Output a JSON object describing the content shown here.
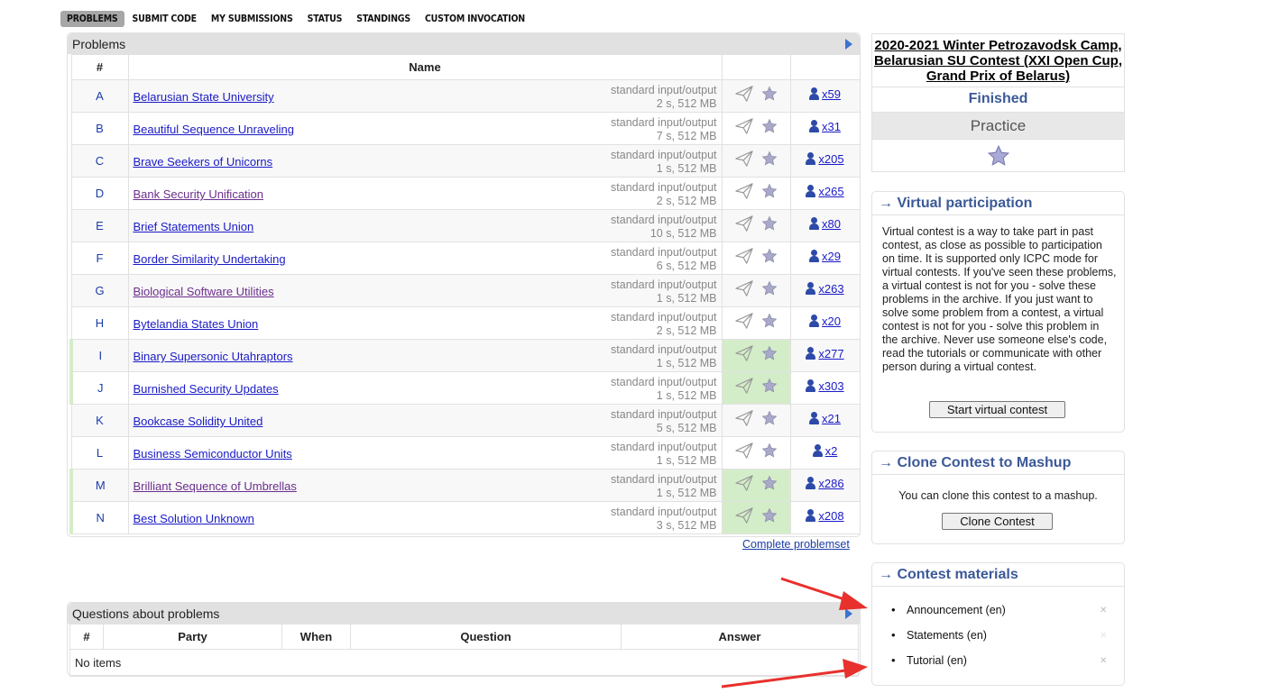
{
  "menu": {
    "items": [
      {
        "label": "PROBLEMS",
        "active": true
      },
      {
        "label": "SUBMIT CODE"
      },
      {
        "label": "MY SUBMISSIONS"
      },
      {
        "label": "STATUS"
      },
      {
        "label": "STANDINGS"
      },
      {
        "label": "CUSTOM INVOCATION"
      }
    ]
  },
  "problems_box": {
    "caption": "Problems",
    "header": {
      "id": "#",
      "name": "Name"
    },
    "rows": [
      {
        "id": "A",
        "name": "Belarusian State University",
        "io": "standard input/output",
        "limits": "2 s, 512 MB",
        "solved": "x59",
        "accepted": false,
        "visited": false
      },
      {
        "id": "B",
        "name": "Beautiful Sequence Unraveling",
        "io": "standard input/output",
        "limits": "7 s, 512 MB",
        "solved": "x31",
        "accepted": false,
        "visited": false
      },
      {
        "id": "C",
        "name": "Brave Seekers of Unicorns",
        "io": "standard input/output",
        "limits": "1 s, 512 MB",
        "solved": "x205",
        "accepted": false,
        "visited": false
      },
      {
        "id": "D",
        "name": "Bank Security Unification",
        "io": "standard input/output",
        "limits": "2 s, 512 MB",
        "solved": "x265",
        "accepted": false,
        "visited": true
      },
      {
        "id": "E",
        "name": "Brief Statements Union",
        "io": "standard input/output",
        "limits": "10 s, 512 MB",
        "solved": "x80",
        "accepted": false,
        "visited": false
      },
      {
        "id": "F",
        "name": "Border Similarity Undertaking",
        "io": "standard input/output",
        "limits": "6 s, 512 MB",
        "solved": "x29",
        "accepted": false,
        "visited": false
      },
      {
        "id": "G",
        "name": "Biological Software Utilities",
        "io": "standard input/output",
        "limits": "1 s, 512 MB",
        "solved": "x263",
        "accepted": false,
        "visited": true
      },
      {
        "id": "H",
        "name": "Bytelandia States Union",
        "io": "standard input/output",
        "limits": "2 s, 512 MB",
        "solved": "x20",
        "accepted": false,
        "visited": false
      },
      {
        "id": "I",
        "name": "Binary Supersonic Utahraptors",
        "io": "standard input/output",
        "limits": "1 s, 512 MB",
        "solved": "x277",
        "accepted": true,
        "visited": false
      },
      {
        "id": "J",
        "name": "Burnished Security Updates",
        "io": "standard input/output",
        "limits": "1 s, 512 MB",
        "solved": "x303",
        "accepted": true,
        "visited": false
      },
      {
        "id": "K",
        "name": "Bookcase Solidity United",
        "io": "standard input/output",
        "limits": "5 s, 512 MB",
        "solved": "x21",
        "accepted": false,
        "visited": false
      },
      {
        "id": "L",
        "name": "Business Semiconductor Units",
        "io": "standard input/output",
        "limits": "1 s, 512 MB",
        "solved": "x2",
        "accepted": false,
        "visited": false
      },
      {
        "id": "M",
        "name": "Brilliant Sequence of Umbrellas",
        "io": "standard input/output",
        "limits": "1 s, 512 MB",
        "solved": "x286",
        "accepted": true,
        "visited": true
      },
      {
        "id": "N",
        "name": "Best Solution Unknown",
        "io": "standard input/output",
        "limits": "3 s, 512 MB",
        "solved": "x208",
        "accepted": true,
        "visited": false
      }
    ],
    "complete_link": "Complete problemset"
  },
  "questions_box": {
    "caption": "Questions about problems",
    "headers": [
      "#",
      "Party",
      "When",
      "Question",
      "Answer"
    ],
    "empty": "No items"
  },
  "sidebar": {
    "contest_title": "2020-2021 Winter Petrozavodsk Camp, Belarusian SU Contest (XXI Open Cup, Grand Prix of Belarus)",
    "status": "Finished",
    "mode": "Practice",
    "virtual": {
      "arrow": "→",
      "title": "Virtual participation",
      "text": "Virtual contest is a way to take part in past contest, as close as possible to participation on time. It is supported only ICPC mode for virtual contests. If you've seen these problems, a virtual contest is not for you - solve these problems in the archive. If you just want to solve some problem from a contest, a virtual contest is not for you - solve this problem in the archive. Never use someone else's code, read the tutorials or communicate with other person during a virtual contest.",
      "button": "Start virtual contest"
    },
    "clone": {
      "arrow": "→",
      "title": "Clone Contest to Mashup",
      "text": "You can clone this contest to a mashup.",
      "button": "Clone Contest"
    },
    "materials": {
      "arrow": "→",
      "title": "Contest materials",
      "items": [
        "Announcement (en)",
        "Statements (en)",
        "Tutorial (en)"
      ]
    }
  },
  "colors": {
    "accepted_bg": "#d4edc9",
    "link": "#1a1ac8",
    "visited_link": "#6b2e8c",
    "caption_blue": "#3b5998",
    "annotation_red": "#e8302c"
  }
}
